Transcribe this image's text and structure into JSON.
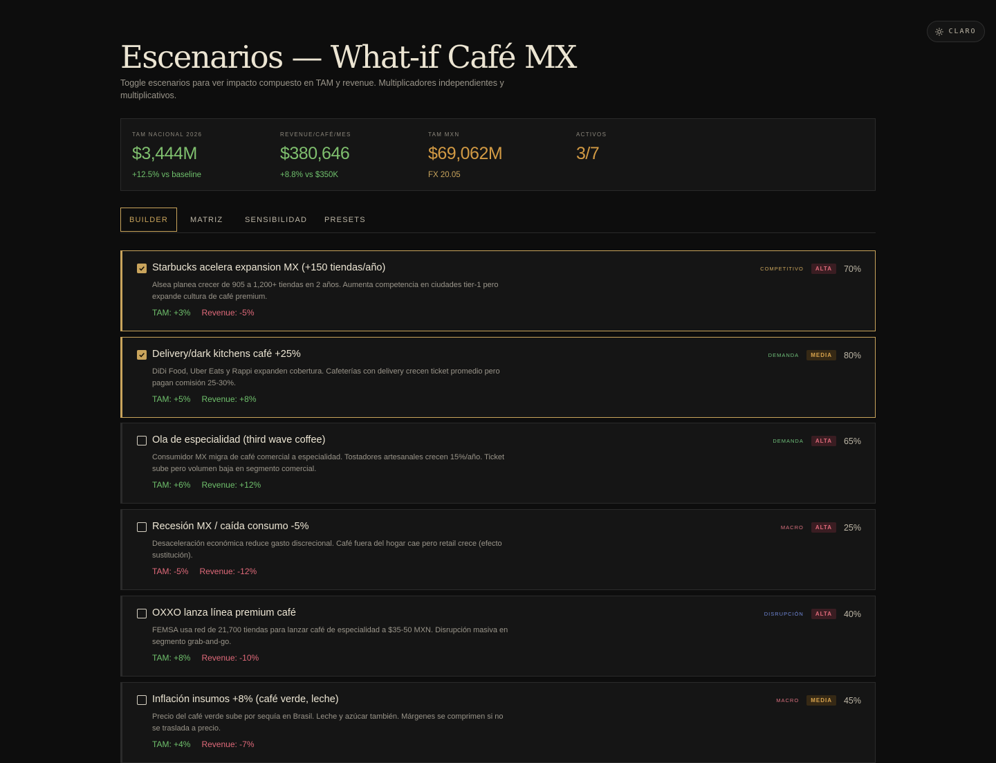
{
  "theme_toggle": {
    "label": "CLARO",
    "icon": "sun-icon"
  },
  "header": {
    "title": "Escenarios — What-if Café MX",
    "subtitle": "Toggle escenarios para ver impacto compuesto en TAM y revenue. Multiplicadores independientes y multiplicativos."
  },
  "kpis": [
    {
      "label": "TAM NACIONAL 2026",
      "value": "$3,444M",
      "note": "+12.5% vs baseline",
      "value_color": "#7fbf6e",
      "note_color": "#6fc06c"
    },
    {
      "label": "REVENUE/CAFÉ/MES",
      "value": "$380,646",
      "note": "+8.8% vs $350K",
      "value_color": "#7fbf6e",
      "note_color": "#6fc06c"
    },
    {
      "label": "TAM MXN",
      "value": "$69,062M",
      "note": "FX 20.05",
      "value_color": "#d29a44",
      "note_color": "#c9a45c"
    },
    {
      "label": "ACTIVOS",
      "value": "3/7",
      "note": "",
      "value_color": "#d29a44",
      "note_color": "#c9a45c"
    }
  ],
  "tabs": [
    {
      "label": "BUILDER",
      "active": true
    },
    {
      "label": "MATRIZ",
      "active": false
    },
    {
      "label": "SENSIBILIDAD",
      "active": false
    },
    {
      "label": "PRESETS",
      "active": false
    }
  ],
  "scenarios": [
    {
      "title": "Starbucks acelera expansion MX (+150 tiendas/año)",
      "description": "Alsea planea crecer de 905 a 1,200+ tiendas en 2 años. Aumenta competencia en ciudades tier-1 pero expande cultura de café premium.",
      "tam": "TAM: +3%",
      "tam_sign": "pos",
      "revenue": "Revenue: -5%",
      "revenue_sign": "neg",
      "category": "COMPETITIVO",
      "category_color": "#c9a45c",
      "priority": "ALTA",
      "probability": "70%",
      "checked": true
    },
    {
      "title": "Delivery/dark kitchens café +25%",
      "description": "DiDi Food, Uber Eats y Rappi expanden cobertura. Cafeterías con delivery crecen ticket promedio pero pagan comisión 25-30%.",
      "tam": "TAM: +5%",
      "tam_sign": "pos",
      "revenue": "Revenue: +8%",
      "revenue_sign": "pos",
      "category": "DEMANDA",
      "category_color": "#6fbf7a",
      "priority": "MEDIA",
      "probability": "80%",
      "checked": true
    },
    {
      "title": "Ola de especialidad (third wave coffee)",
      "description": "Consumidor MX migra de café comercial a especialidad. Tostadores artesanales crecen 15%/año. Ticket sube pero volumen baja en segmento comercial.",
      "tam": "TAM: +6%",
      "tam_sign": "pos",
      "revenue": "Revenue: +12%",
      "revenue_sign": "pos",
      "category": "DEMANDA",
      "category_color": "#6fbf7a",
      "priority": "ALTA",
      "probability": "65%",
      "checked": false
    },
    {
      "title": "Recesión MX / caída consumo -5%",
      "description": "Desaceleración económica reduce gasto discrecional. Café fuera del hogar cae pero retail crece (efecto sustitución).",
      "tam": "TAM: -5%",
      "tam_sign": "neg",
      "revenue": "Revenue: -12%",
      "revenue_sign": "neg",
      "category": "MACRO",
      "category_color": "#d9707e",
      "priority": "ALTA",
      "probability": "25%",
      "checked": false
    },
    {
      "title": "OXXO lanza línea premium café",
      "description": "FEMSA usa red de 21,700 tiendas para lanzar café de especialidad a $35-50 MXN. Disrupción masiva en segmento grab-and-go.",
      "tam": "TAM: +8%",
      "tam_sign": "pos",
      "revenue": "Revenue: -10%",
      "revenue_sign": "neg",
      "category": "DISRUPCIÓN",
      "category_color": "#6f86d6",
      "priority": "ALTA",
      "probability": "40%",
      "checked": false
    },
    {
      "title": "Inflación insumos +8% (café verde, leche)",
      "description": "Precio del café verde sube por sequía en Brasil. Leche y azúcar también. Márgenes se comprimen si no se traslada a precio.",
      "tam": "TAM: +4%",
      "tam_sign": "pos",
      "revenue": "Revenue: -7%",
      "revenue_sign": "neg",
      "category": "MACRO",
      "category_color": "#d9707e",
      "priority": "MEDIA",
      "probability": "45%",
      "checked": false
    }
  ]
}
